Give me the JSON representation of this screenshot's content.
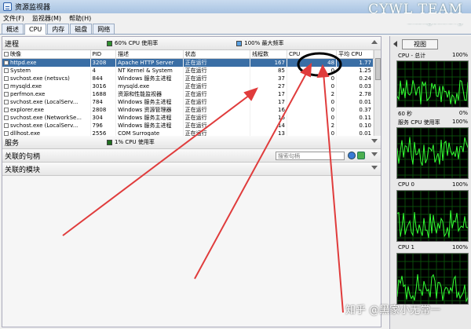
{
  "window": {
    "title": "资源监视器"
  },
  "watermark": {
    "line1": "CYWL TEAM",
    "line2": "ChengYin.Org",
    "bottom": "知乎 @黑家小无常一"
  },
  "menu": [
    "文件(F)",
    "监视器(M)",
    "帮助(H)"
  ],
  "tabs": [
    "概述",
    "CPU",
    "内存",
    "磁盘",
    "网络"
  ],
  "process_section": {
    "title": "进程",
    "legend_cpu": "60% CPU 使用率",
    "legend_freq": "100% 最大频率",
    "legend_cpu_color": "#2f8f2f",
    "legend_freq_color": "#5aa0e0",
    "columns": [
      "映像",
      "PID",
      "描述",
      "状态",
      "线程数",
      "CPU",
      "平均 CPU"
    ],
    "rows": [
      [
        "httpd.exe",
        "3208",
        "Apache HTTP Server",
        "正在运行",
        "167",
        "48",
        "1.77"
      ],
      [
        "System",
        "4",
        "NT Kernel & System",
        "正在运行",
        "85",
        "0",
        "1.25"
      ],
      [
        "svchost.exe (netsvcs)",
        "844",
        "Windows 服务主进程",
        "正在运行",
        "37",
        "0",
        "0.24"
      ],
      [
        "mysqld.exe",
        "3016",
        "mysqld.exe",
        "正在运行",
        "27",
        "0",
        "0.03"
      ],
      [
        "perfmon.exe",
        "1688",
        "资源和性能监视器",
        "正在运行",
        "17",
        "2",
        "2.78"
      ],
      [
        "svchost.exe (LocalServ...",
        "784",
        "Windows 服务主进程",
        "正在运行",
        "17",
        "0",
        "0.01"
      ],
      [
        "explorer.exe",
        "2808",
        "Windows 资源管理器",
        "正在运行",
        "16",
        "0",
        "0.37"
      ],
      [
        "svchost.exe (NetworkSe...",
        "304",
        "Windows 服务主进程",
        "正在运行",
        "16",
        "0",
        "0.11"
      ],
      [
        "svchost.exe (LocalServ...",
        "796",
        "Windows 服务主进程",
        "正在运行",
        "14",
        "2",
        "0.10"
      ],
      [
        "dllhost.exe",
        "2556",
        "COM Surrogate",
        "正在运行",
        "13",
        "0",
        "0.01"
      ]
    ]
  },
  "services_section": {
    "title": "服务",
    "legend": "1% CPU 使用率",
    "legend_color": "#1f6f1f"
  },
  "handles_section": {
    "title": "关联的句柄",
    "search_placeholder": "搜索句柄"
  },
  "modules_section": {
    "title": "关联的模块"
  },
  "right_panel": {
    "view_label": "视图",
    "graphs": [
      {
        "label": "CPU - 总计",
        "value": "100%"
      },
      {
        "label": "服务 CPU 使用率",
        "value": "100%"
      },
      {
        "label": "CPU 0",
        "value": "100%"
      },
      {
        "label": "CPU 1",
        "value": "100%"
      }
    ],
    "time_left": "60 秒",
    "time_right": "0%",
    "time_right2": "0%"
  }
}
